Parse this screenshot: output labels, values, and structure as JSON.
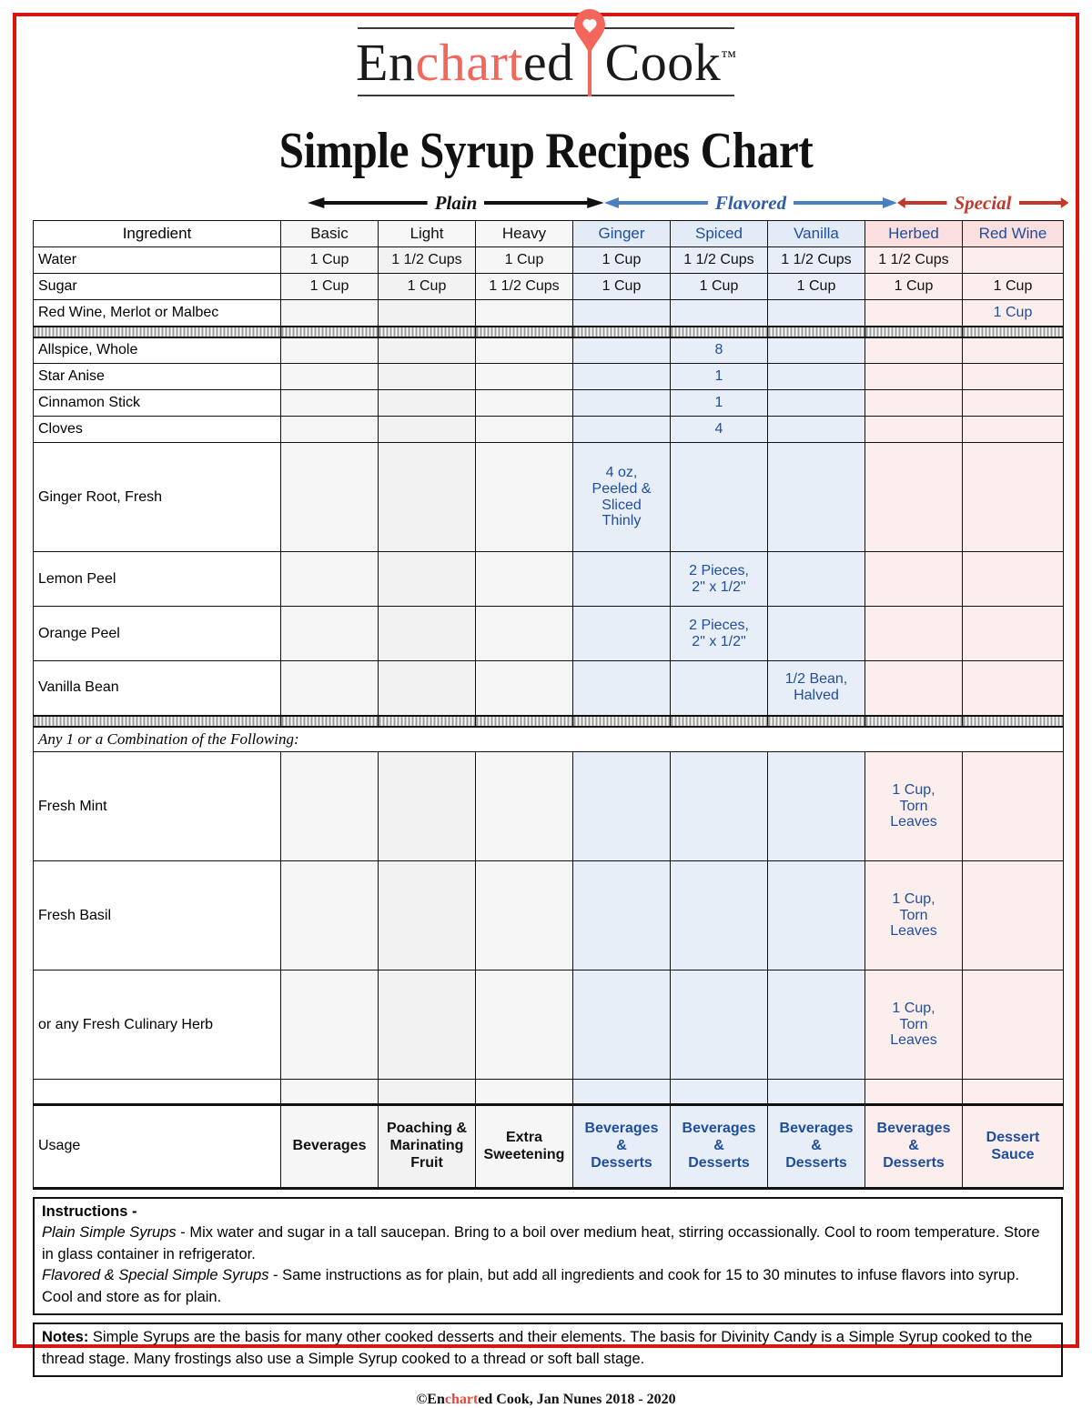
{
  "brand": {
    "logo_part1": "En",
    "logo_highlight": "chart",
    "logo_part2": "ed",
    "logo_word2": "Cook",
    "trademark": "™",
    "heart_icon": "heart-pin-icon",
    "accent_color": "#f2665c"
  },
  "page_title": "Simple Syrup Recipes Chart",
  "categories": [
    {
      "label": "Plain",
      "color": "#111111"
    },
    {
      "label": "Flavored",
      "color": "#2d5ca8"
    },
    {
      "label": "Special",
      "color": "#c0392b"
    }
  ],
  "chart_data": {
    "type": "table",
    "title": "Simple Syrup Recipes Chart",
    "columns": [
      "Ingredient",
      "Basic",
      "Light",
      "Heavy",
      "Ginger",
      "Spiced",
      "Vanilla",
      "Herbed",
      "Red Wine"
    ],
    "column_groups": [
      "Plain",
      "Plain",
      "Plain",
      "Flavored",
      "Flavored",
      "Flavored",
      "Special",
      "Special"
    ],
    "rows": [
      {
        "ingredient": "Water",
        "values": [
          "1 Cup",
          "1 1/2 Cups",
          "1 Cup",
          "1 Cup",
          "1 1/2 Cups",
          "1 1/2 Cups",
          "1 1/2 Cups",
          ""
        ]
      },
      {
        "ingredient": "Sugar",
        "values": [
          "1 Cup",
          "1 Cup",
          "1 1/2 Cups",
          "1 Cup",
          "1 Cup",
          "1 Cup",
          "1 Cup",
          "1 Cup"
        ]
      },
      {
        "ingredient": "Red Wine, Merlot or Malbec",
        "values": [
          "",
          "",
          "",
          "",
          "",
          "",
          "",
          "1 Cup"
        ]
      },
      {
        "ingredient": "Allspice, Whole",
        "values": [
          "",
          "",
          "",
          "",
          "8",
          "",
          "",
          ""
        ]
      },
      {
        "ingredient": "Star Anise",
        "values": [
          "",
          "",
          "",
          "",
          "1",
          "",
          "",
          ""
        ]
      },
      {
        "ingredient": "Cinnamon Stick",
        "values": [
          "",
          "",
          "",
          "",
          "1",
          "",
          "",
          ""
        ]
      },
      {
        "ingredient": "Cloves",
        "values": [
          "",
          "",
          "",
          "",
          "4",
          "",
          "",
          ""
        ]
      },
      {
        "ingredient": "Ginger Root, Fresh",
        "values": [
          "",
          "",
          "",
          "4 oz,\nPeeled &\nSliced\nThinly",
          "",
          "",
          "",
          ""
        ]
      },
      {
        "ingredient": "Lemon Peel",
        "values": [
          "",
          "",
          "",
          "",
          "2 Pieces,\n2\" x 1/2\"",
          "",
          "",
          ""
        ]
      },
      {
        "ingredient": "Orange Peel",
        "values": [
          "",
          "",
          "",
          "",
          "2 Pieces,\n2\" x 1/2\"",
          "",
          "",
          ""
        ]
      },
      {
        "ingredient": "Vanilla Bean",
        "values": [
          "",
          "",
          "",
          "",
          "",
          "1/2 Bean,\nHalved",
          "",
          ""
        ]
      },
      {
        "ingredient": "Fresh Mint",
        "values": [
          "",
          "",
          "",
          "",
          "",
          "",
          "1 Cup,\nTorn\nLeaves",
          ""
        ]
      },
      {
        "ingredient": "Fresh Basil",
        "values": [
          "",
          "",
          "",
          "",
          "",
          "",
          "1 Cup,\nTorn\nLeaves",
          ""
        ]
      },
      {
        "ingredient": "or any Fresh Culinary Herb",
        "values": [
          "",
          "",
          "",
          "",
          "",
          "",
          "1 Cup,\nTorn\nLeaves",
          ""
        ]
      },
      {
        "ingredient": "Usage",
        "values": [
          "Beverages",
          "Poaching &\nMarinating\nFruit",
          "Extra\nSweetening",
          "Beverages\n&\nDesserts",
          "Beverages\n&\nDesserts",
          "Beverages\n&\nDesserts",
          "Beverages\n&\nDesserts",
          "Dessert\nSauce"
        ]
      }
    ],
    "section_note": "Any 1 or a Combination of the Following:",
    "flavored_tint": "#e8eef7",
    "special_tint": "#fdeeee"
  },
  "instructions": {
    "heading": "Instructions -",
    "line1_label": "Plain Simple Syrups",
    "line1_text": " - Mix water and sugar in a tall saucepan.  Bring to a boil over medium heat, stirring occassionally.  Cool to room temperature.  Store in glass container in refrigerator.",
    "line2_label": "Flavored & Special Simple Syrups",
    "line2_text": " - Same instructions as for plain, but add all ingredients and cook for 15 to 30 minutes to infuse flavors into syrup.  Cool and store as for plain."
  },
  "notes": {
    "label": "Notes:",
    "text": " Simple Syrups are the basis for many other cooked desserts and their elements.  The basis for Divinity Candy is a Simple Syrup cooked to the thread stage.  Many frostings also use a Simple Syrup cooked to a thread or soft ball stage."
  },
  "footer": {
    "prefix": "©En",
    "highlight": "chart",
    "suffix": "ed Cook, Jan Nunes 2018 - 2020"
  }
}
